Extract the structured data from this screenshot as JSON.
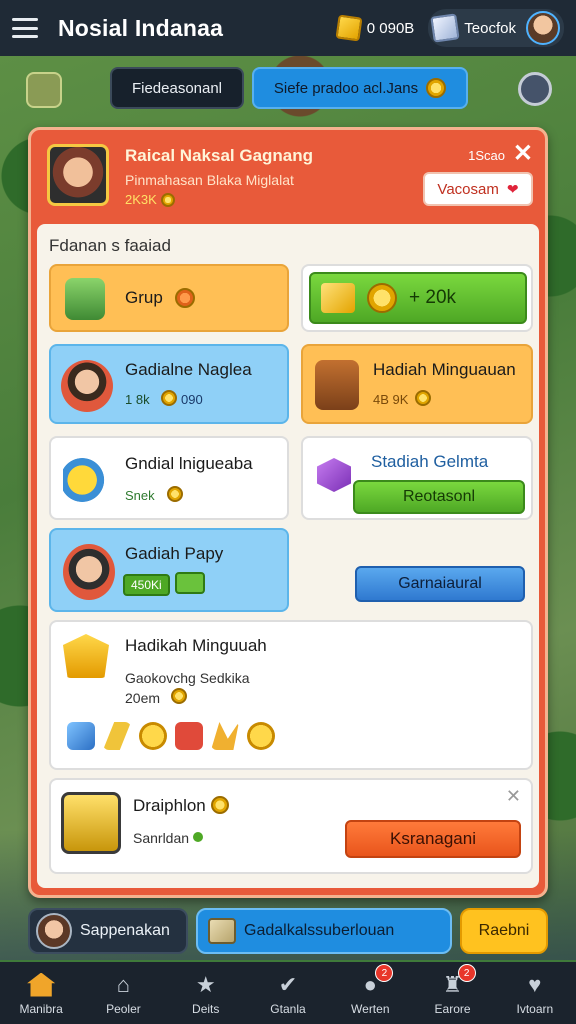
{
  "app": {
    "title": "Nosial Indanaa",
    "currency_amount": "0 090B",
    "player_name": "Teocfok"
  },
  "subbar": {
    "dark_button": "Fiedeasonanl",
    "blue_button": "Siefe pradoo acl.Jans"
  },
  "panel": {
    "header": {
      "title": "Raical Naksal Gagnang",
      "subtitle": "Pinmahasan Blaka Miglalat",
      "amount": "2K3K",
      "count": "1Scao",
      "button": "Vacosam"
    },
    "section_title": "Fdanan s faaiad",
    "cards": {
      "grup": {
        "title": "Grup"
      },
      "reward_green": {
        "amount": "+ 20k"
      },
      "gadialne": {
        "title": "Gadialne Naglea",
        "sub": "1 8k",
        "sub2": "090"
      },
      "hadiah_minguauan": {
        "title": "Hadiah Minguauan",
        "sub": "4B 9K"
      },
      "gndial": {
        "title": "Gndial lnigueaba",
        "sub": "Snek"
      },
      "stadiah": {
        "title": "Stadiah Gelmta",
        "button": "Reotasonl"
      },
      "gadiah_papy": {
        "title": "Gadiah Papy",
        "badge": "450Ki"
      },
      "garnaiaural": {
        "button": "Garnaiaural"
      },
      "hadikah": {
        "title": "Hadikah Minguuah",
        "line1": "Gaokovchg Sedkika",
        "line2": "20em"
      },
      "draiphion": {
        "title": "Draiphlon",
        "sub": "Sanrldan",
        "button": "Ksranagani"
      }
    }
  },
  "actionbar": {
    "profile": "Sappenakan",
    "middle": "Gadalkalssuberlouan",
    "right": "Raebni"
  },
  "nav": [
    {
      "label": "Manibra",
      "icon": "home-icon"
    },
    {
      "label": "Peoler",
      "icon": "shop-icon"
    },
    {
      "label": "Deits",
      "icon": "star-icon"
    },
    {
      "label": "Gtanla",
      "icon": "check-icon",
      "badge": ""
    },
    {
      "label": "Werten",
      "icon": "chat-icon",
      "badge": "2"
    },
    {
      "label": "Earore",
      "icon": "trophy-icon",
      "badge": "2"
    },
    {
      "label": "Ivtoarn",
      "icon": "heart-icon"
    }
  ],
  "colors": {
    "topbar": "#1f2a36",
    "panel": "#e85a3a",
    "accent_blue": "#1f8de0",
    "accent_green": "#4ea825",
    "accent_orange": "#e9551c"
  }
}
